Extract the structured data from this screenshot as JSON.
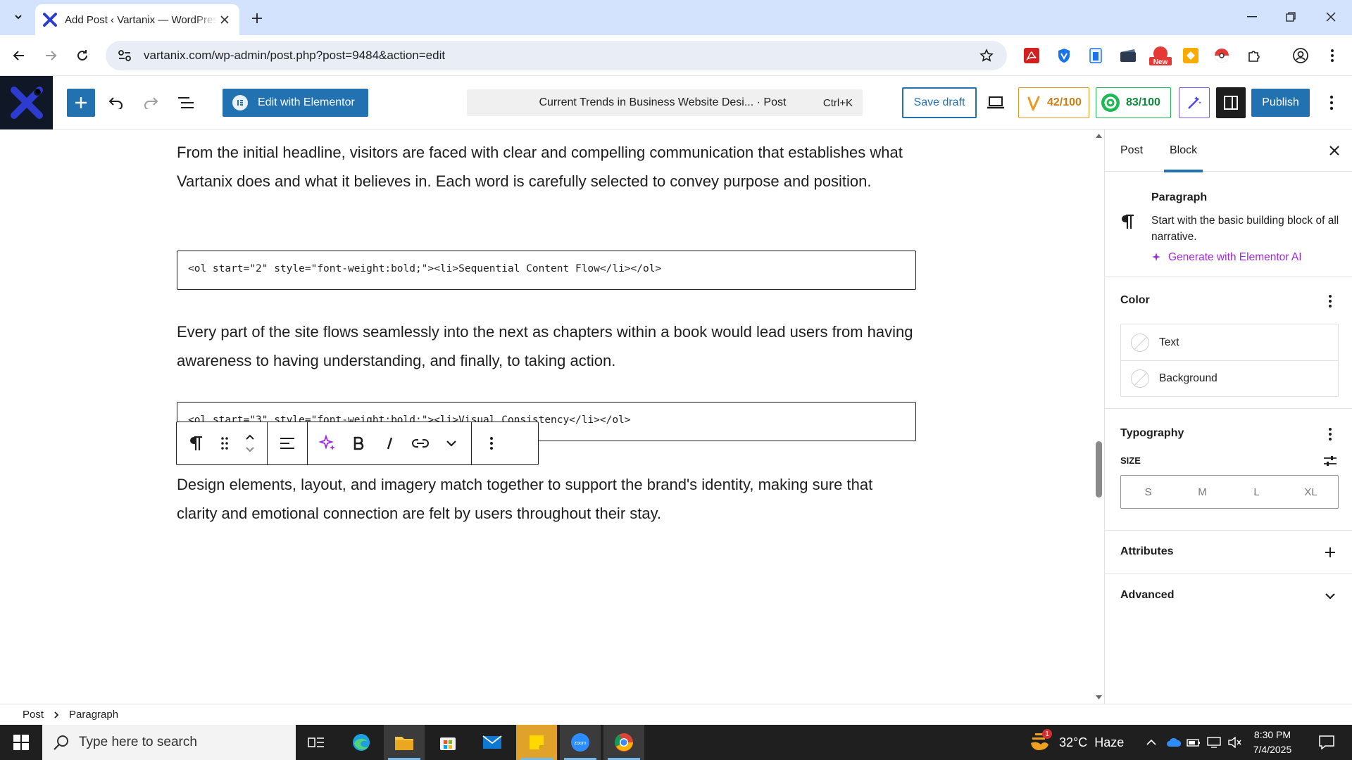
{
  "browser": {
    "tab_title": "Add Post ‹ Vartanix — WordPress",
    "url": "vartanix.com/wp-admin/post.php?post=9484&action=edit",
    "new_badge": "New"
  },
  "editor_header": {
    "edit_with_elementor": "Edit with Elementor",
    "document_title": "Current Trends in Business Website Desi... · Post",
    "shortcut": "Ctrl+K",
    "save_draft": "Save draft",
    "score_a": "42/100",
    "score_b": "83/100",
    "publish": "Publish"
  },
  "content": {
    "para1": "From the initial headline, visitors are faced with clear and compelling communication that establishes what Vartanix does and what it believes in. Each word is carefully selected to convey purpose and position.",
    "html1": "<ol start=\"2\" style=\"font-weight:bold;\"><li>Sequential Content Flow</li></ol>",
    "para2": "Every part of the site flows seamlessly into the next as chapters within a book would lead users from having awareness to having understanding, and finally, to taking action.",
    "html2": "<ol start=\"3\" style=\"font-weight:bold;\"><li>Visual Consistency</li></ol>",
    "para3": "Design elements, layout, and imagery match together to support the brand's identity, making sure that clarity and emotional connection are felt by users throughout their stay."
  },
  "sidebar": {
    "tabs": [
      {
        "label": "Post"
      },
      {
        "label": "Block"
      }
    ],
    "active_tab": "Block",
    "block_name": "Paragraph",
    "block_description": "Start with the basic building block of all narrative.",
    "generate_ai": "Generate with Elementor AI",
    "color_title": "Color",
    "color_items": [
      {
        "label": "Text"
      },
      {
        "label": "Background"
      }
    ],
    "typography_title": "Typography",
    "size_label": "SIZE",
    "sizes": [
      "S",
      "M",
      "L",
      "XL"
    ],
    "attributes_title": "Attributes",
    "advanced_title": "Advanced"
  },
  "breadcrumb": [
    "Post",
    "Paragraph"
  ],
  "taskbar": {
    "search_placeholder": "Type here to search",
    "weather_badge": "1",
    "weather": "32°C  Haze",
    "time": "8:30 PM",
    "date": "7/4/2025"
  },
  "colors": {
    "wp_blue": "#2271b1",
    "ai_purple": "#9b2bd6",
    "tabstrip": "#d3e3fd",
    "taskbar": "#1f1f1f"
  }
}
